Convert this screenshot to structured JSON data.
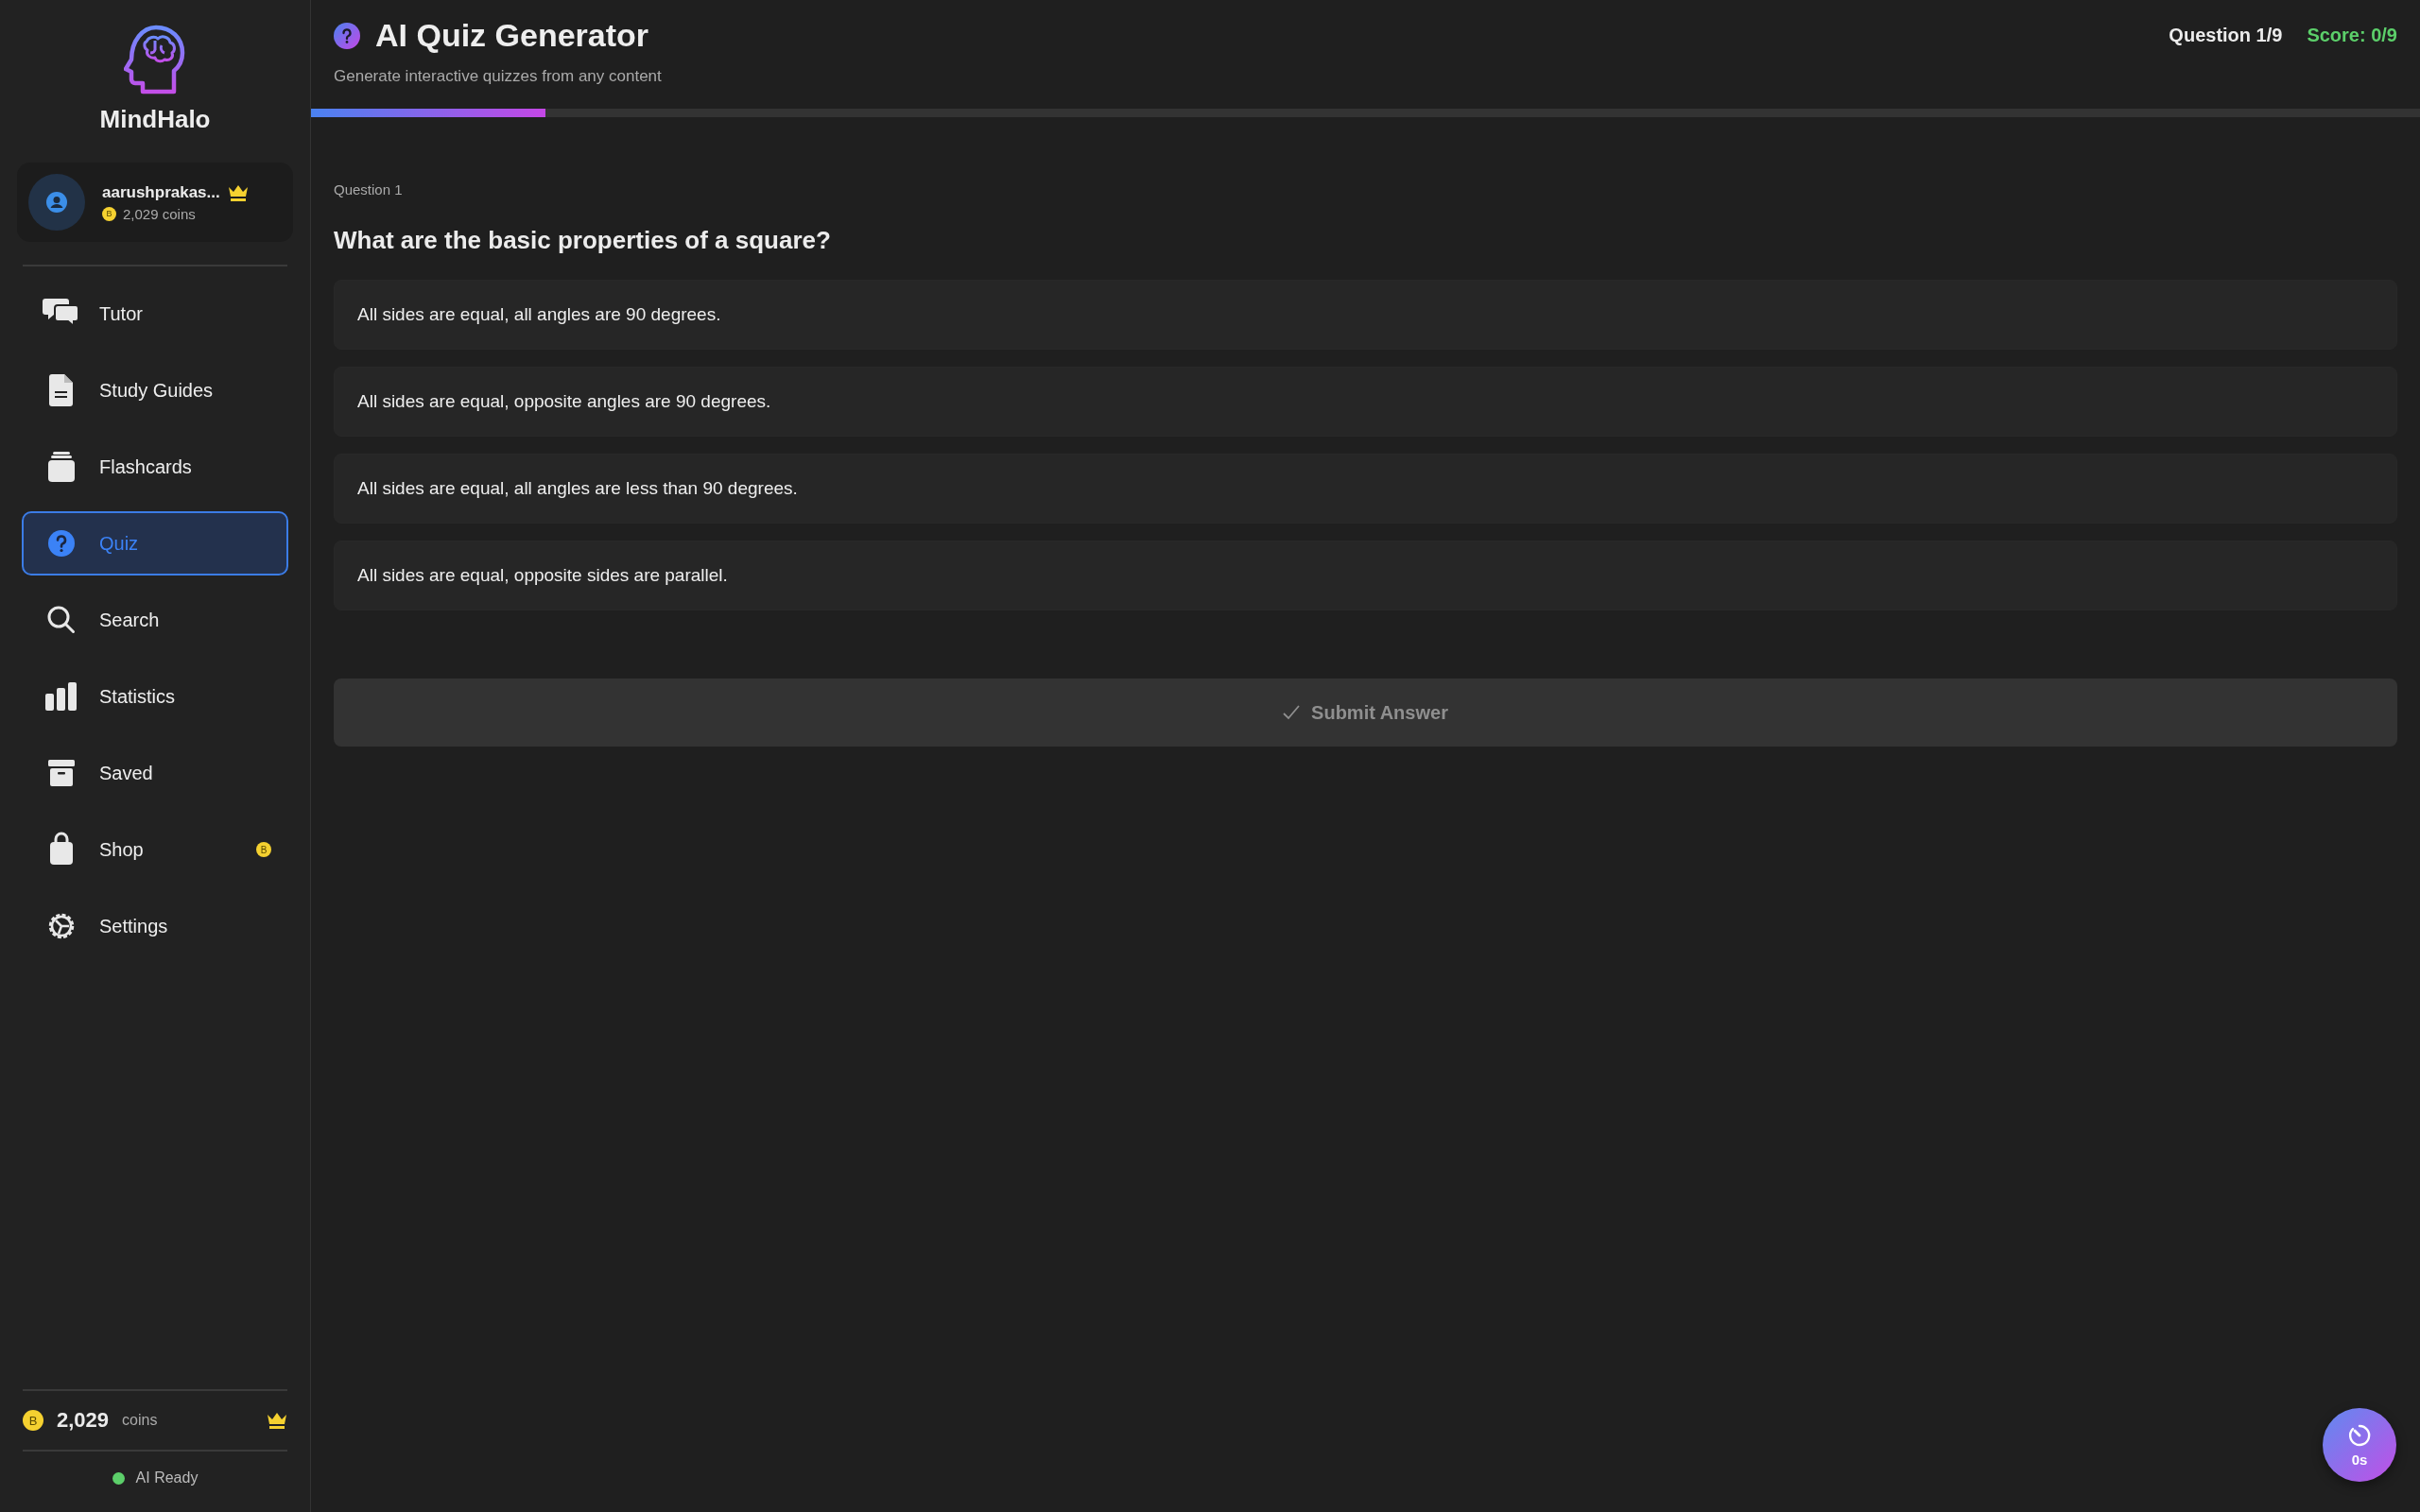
{
  "sidebar": {
    "brand": "MindHalo",
    "user": {
      "name": "aarushprakas...",
      "coin_symbol": "B",
      "coins": "2,029 coins"
    },
    "items": [
      {
        "label": "Tutor",
        "selected": false
      },
      {
        "label": "Study Guides",
        "selected": false
      },
      {
        "label": "Flashcards",
        "selected": false
      },
      {
        "label": "Quiz",
        "selected": true
      },
      {
        "label": "Search",
        "selected": false
      },
      {
        "label": "Statistics",
        "selected": false
      },
      {
        "label": "Saved",
        "selected": false
      },
      {
        "label": "Shop",
        "selected": false,
        "badge": "B"
      },
      {
        "label": "Settings",
        "selected": false
      }
    ],
    "footer": {
      "coin_symbol": "B",
      "coins": "2,029",
      "unit": "coins",
      "status": {
        "text": "AI Ready",
        "color": "#5ccf6a"
      }
    }
  },
  "header": {
    "title": "AI Quiz Generator",
    "subtitle": "Generate interactive quizzes from any content",
    "question_counter": "Question 1/9",
    "score": "Score: 0/9"
  },
  "progress": {
    "level": 0.111
  },
  "question": {
    "number": "Question 1",
    "text": "What are the basic properties of a square?",
    "options": [
      {
        "text": "All sides are equal, all angles are 90 degrees.",
        "selected": false
      },
      {
        "text": "All sides are equal, opposite angles are 90 degrees.",
        "selected": false
      },
      {
        "text": "All sides are equal, all angles are less than 90 degrees.",
        "selected": false
      },
      {
        "text": "All sides are equal, opposite sides are parallel.",
        "selected": false
      }
    ],
    "submit": {
      "label": "Submit Answer",
      "disabled": true
    }
  },
  "timer": {
    "reading": "0s"
  }
}
